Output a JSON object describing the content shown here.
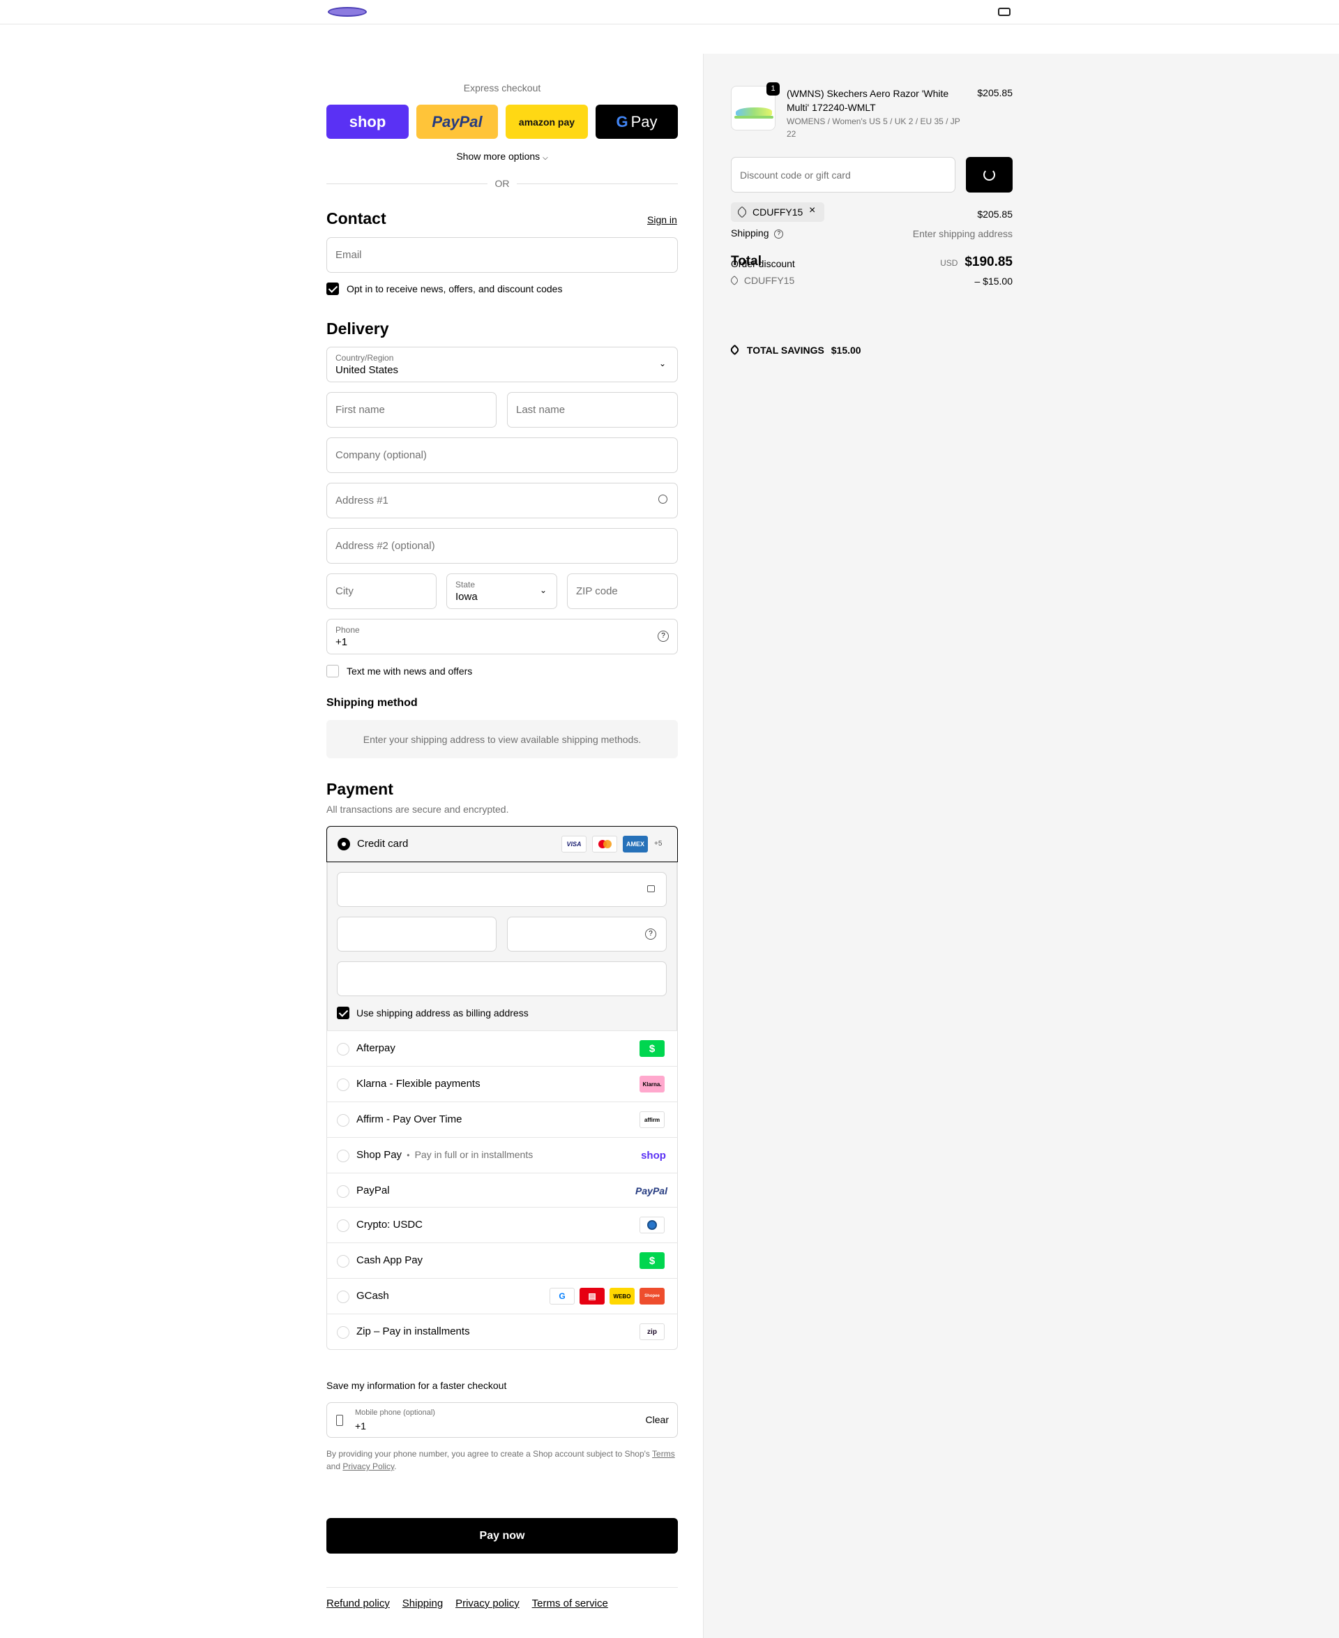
{
  "header": {
    "logo_icon": "brand-logo",
    "cart_icon": "bag-icon"
  },
  "express": {
    "title": "Express checkout",
    "buttons": {
      "shop": "shop",
      "paypal": "PayPal",
      "amazon": "amazon pay",
      "gpay": "Pay"
    },
    "show_more": "Show more options",
    "or": "OR"
  },
  "contact": {
    "title": "Contact",
    "sign_in": "Sign in",
    "email_placeholder": "Email",
    "opt_in": "Opt in to receive news, offers, and discount codes"
  },
  "delivery": {
    "title": "Delivery",
    "country_label": "Country/Region",
    "country_value": "United States",
    "first_name": "First name",
    "last_name": "Last name",
    "company": "Company (optional)",
    "address1": "Address #1",
    "address2": "Address #2 (optional)",
    "city": "City",
    "state_label": "State",
    "state_value": "Iowa",
    "zip": "ZIP code",
    "phone_label": "Phone",
    "phone_value": "+1",
    "text_me": "Text me with news and offers"
  },
  "shipping_method": {
    "title": "Shipping method",
    "message": "Enter your shipping address to view available shipping methods."
  },
  "payment": {
    "title": "Payment",
    "subtitle": "All transactions are secure and encrypted.",
    "credit_card": "Credit card",
    "card_badges": [
      "VISA",
      "MC",
      "AMEX"
    ],
    "more_cards": "+5",
    "use_shipping": "Use shipping address as billing address",
    "methods": [
      {
        "label": "Afterpay"
      },
      {
        "label": "Klarna - Flexible payments",
        "badge": "Klarna."
      },
      {
        "label": "Affirm - Pay Over Time",
        "badge": "affirm"
      },
      {
        "label": "Shop Pay",
        "sub": "Pay in full or in installments",
        "badge": "shop"
      },
      {
        "label": "PayPal",
        "badge": "PayPal"
      },
      {
        "label": "Crypto: USDC"
      },
      {
        "label": "Cash App Pay"
      },
      {
        "label": "GCash",
        "badges": [
          "WEBO",
          "Shopee"
        ]
      },
      {
        "label": "Zip – Pay in installments",
        "badge": "zip"
      }
    ],
    "bullet": "•"
  },
  "save_info": {
    "title": "Save my information for a faster checkout",
    "mobile_label": "Mobile phone (optional)",
    "mobile_value": "+1",
    "clear": "Clear",
    "legal_1": "By providing your phone number, you agree to create a Shop account subject to Shop's",
    "terms": "Terms",
    "and": "and",
    "privacy": "Privacy Policy",
    "period": "."
  },
  "pay_now": "Pay now",
  "footer": [
    "Refund policy",
    "Shipping",
    "Privacy policy",
    "Terms of service"
  ],
  "summary": {
    "product": {
      "qty": "1",
      "name": "(WMNS) Skechers Aero Razor 'White Multi' 172240-WMLT",
      "variant": "WOMENS / Women's US 5 / UK 2 / EU 35 / JP 22",
      "price": "$205.85"
    },
    "discount_placeholder": "Discount code or gift card",
    "applied_code": "CDUFFY15",
    "subtotal_value": "$205.85",
    "shipping_label": "Shipping",
    "shipping_value": "Enter shipping address",
    "total_label": "Total",
    "order_discount_label": "Order discount",
    "currency": "USD",
    "total_value": "$190.85",
    "discount_code": "CDUFFY15",
    "discount_value": "– $15.00",
    "savings_label": "TOTAL SAVINGS",
    "savings_value": "$15.00"
  }
}
